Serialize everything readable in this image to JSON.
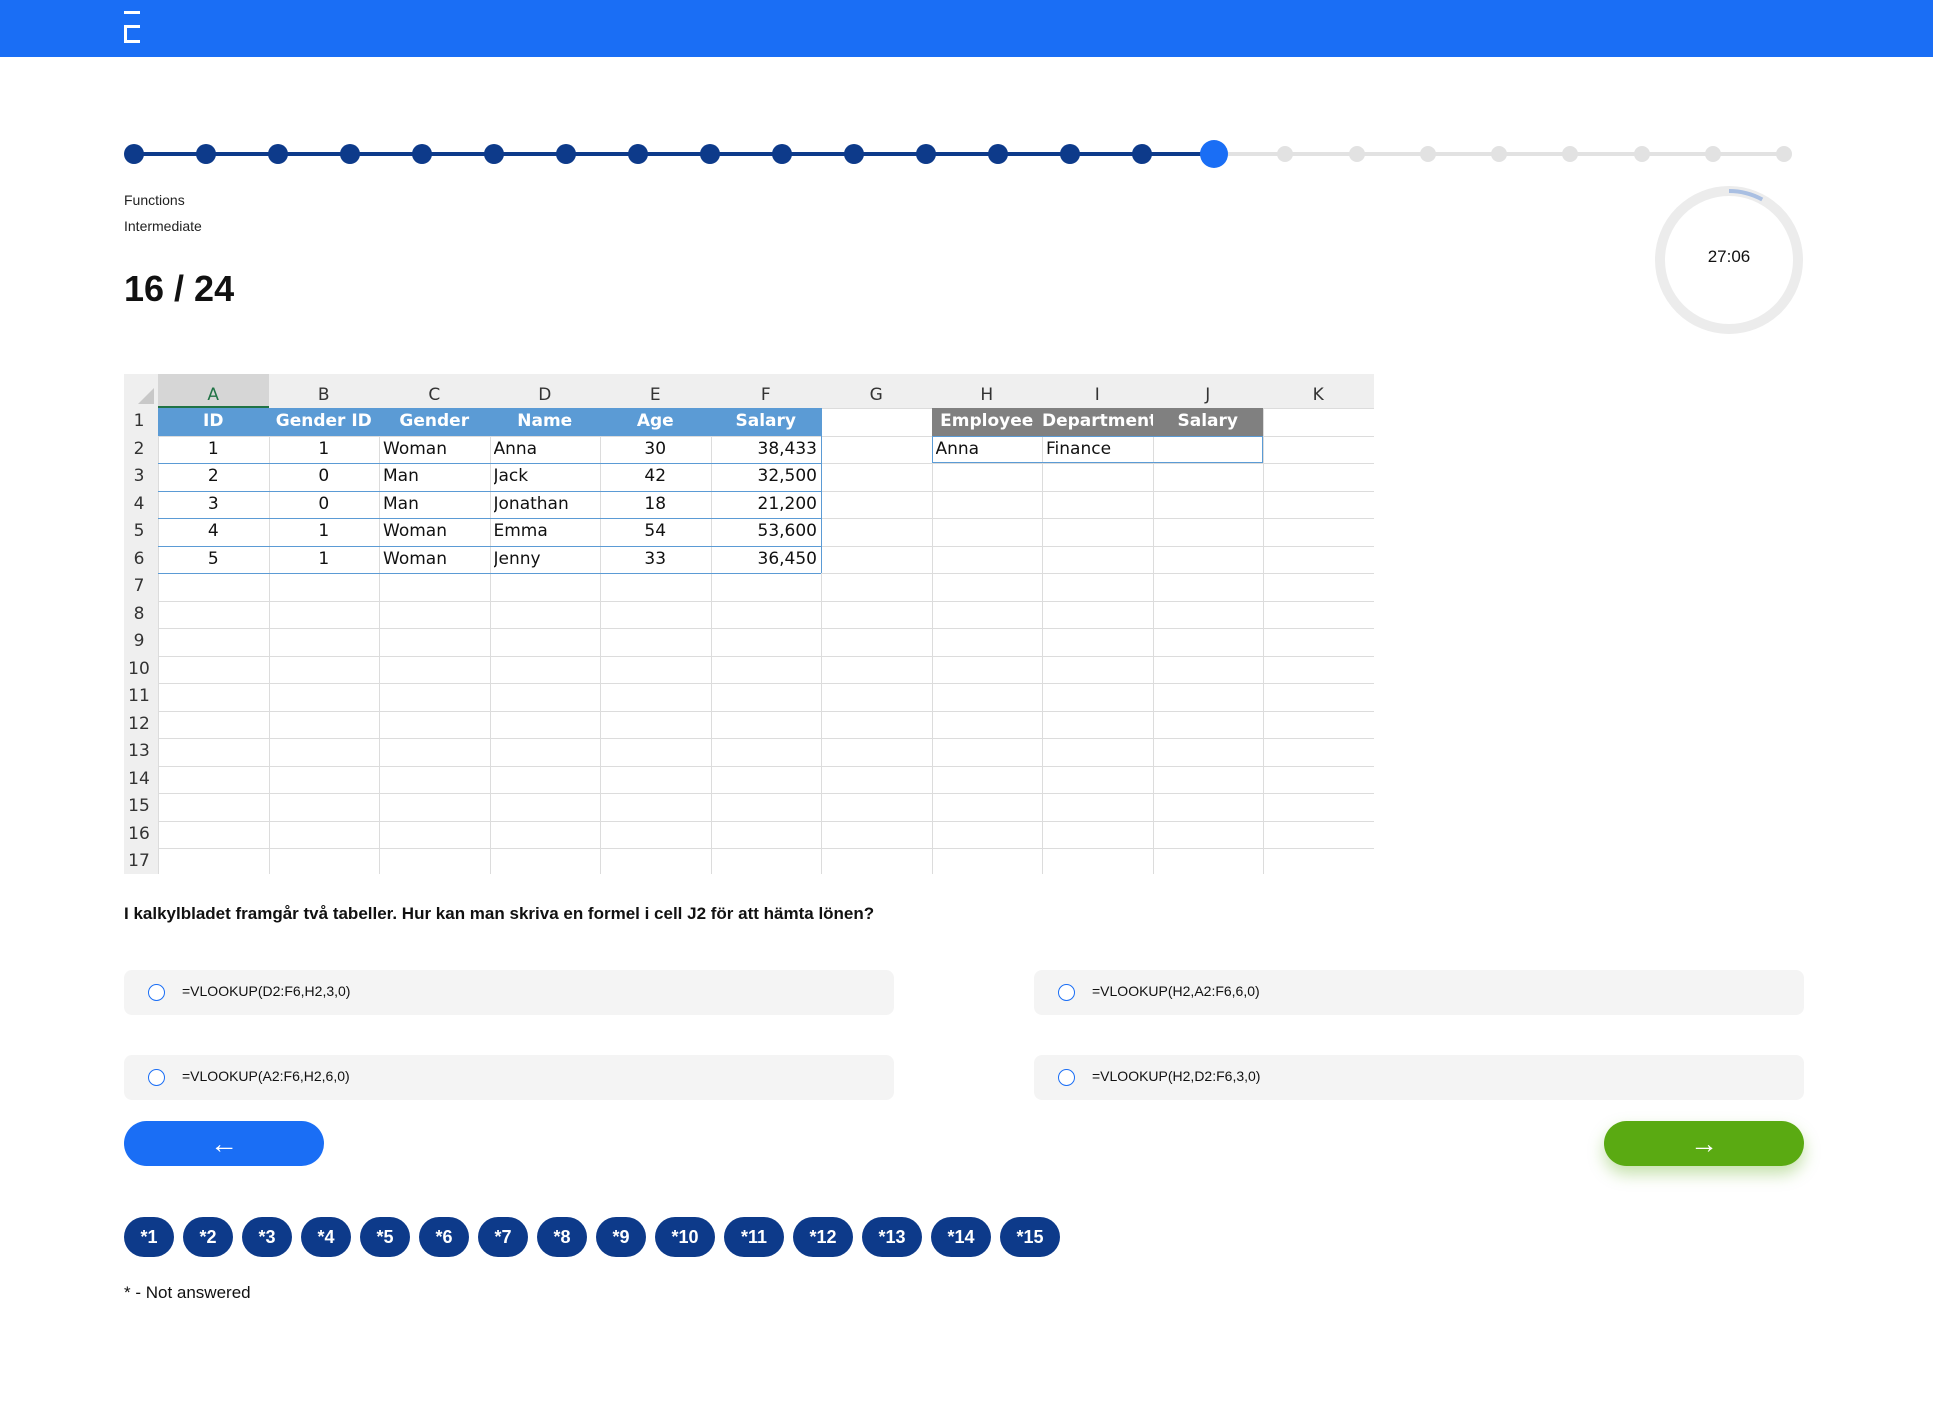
{
  "header": {
    "logo_icon": "brand-bracket-icon",
    "brand_color": "#1a6ef5"
  },
  "progress": {
    "total": 24,
    "current": 16,
    "done_color": "#0d3a8a",
    "current_color": "#1a6ef5",
    "todo_color": "#e2e2e2"
  },
  "quiz": {
    "category": "Functions",
    "level": "Intermediate",
    "counter": "16 / 24"
  },
  "timer": {
    "time": "27:06",
    "remaining_fraction": 0.08
  },
  "spreadsheet": {
    "columns": [
      "A",
      "B",
      "C",
      "D",
      "E",
      "F",
      "G",
      "H",
      "I",
      "J",
      "K"
    ],
    "row_numbers": [
      "1",
      "2",
      "3",
      "4",
      "5",
      "6",
      "7",
      "8",
      "9",
      "10",
      "11",
      "12",
      "13",
      "14",
      "15",
      "16",
      "17"
    ],
    "table1": {
      "headers": [
        "ID",
        "Gender ID",
        "Gender",
        "Name",
        "Age",
        "Salary"
      ],
      "rows": [
        [
          "1",
          "1",
          "Woman",
          "Anna",
          "30",
          "38,433"
        ],
        [
          "2",
          "0",
          "Man",
          "Jack",
          "42",
          "32,500"
        ],
        [
          "3",
          "0",
          "Man",
          "Jonathan",
          "18",
          "21,200"
        ],
        [
          "4",
          "1",
          "Woman",
          "Emma",
          "54",
          "53,600"
        ],
        [
          "5",
          "1",
          "Woman",
          "Jenny",
          "33",
          "36,450"
        ]
      ],
      "header_color": "#5b9bd5"
    },
    "table2": {
      "headers": [
        "Employee",
        "Department",
        "Salary"
      ],
      "rows": [
        [
          "Anna",
          "Finance",
          ""
        ]
      ],
      "header_color": "#808080"
    }
  },
  "question": "I kalkylbladet framgår två tabeller. Hur kan man skriva en formel i cell J2 för att hämta lönen?",
  "options": [
    "=VLOOKUP(D2:F6,H2,3,0)",
    "=VLOOKUP(H2,A2:F6,6,0)",
    "=VLOOKUP(A2:F6,H2,6,0)",
    "=VLOOKUP(H2,D2:F6,3,0)"
  ],
  "navigation": {
    "back_icon": "arrow-left-icon",
    "back_glyph": "←",
    "next_icon": "arrow-right-icon",
    "next_glyph": "→",
    "next_color": "#5aaa12"
  },
  "question_nav": [
    "*1",
    "*2",
    "*3",
    "*4",
    "*5",
    "*6",
    "*7",
    "*8",
    "*9",
    "*10",
    "*11",
    "*12",
    "*13",
    "*14",
    "*15"
  ],
  "legend": "* - Not answered"
}
